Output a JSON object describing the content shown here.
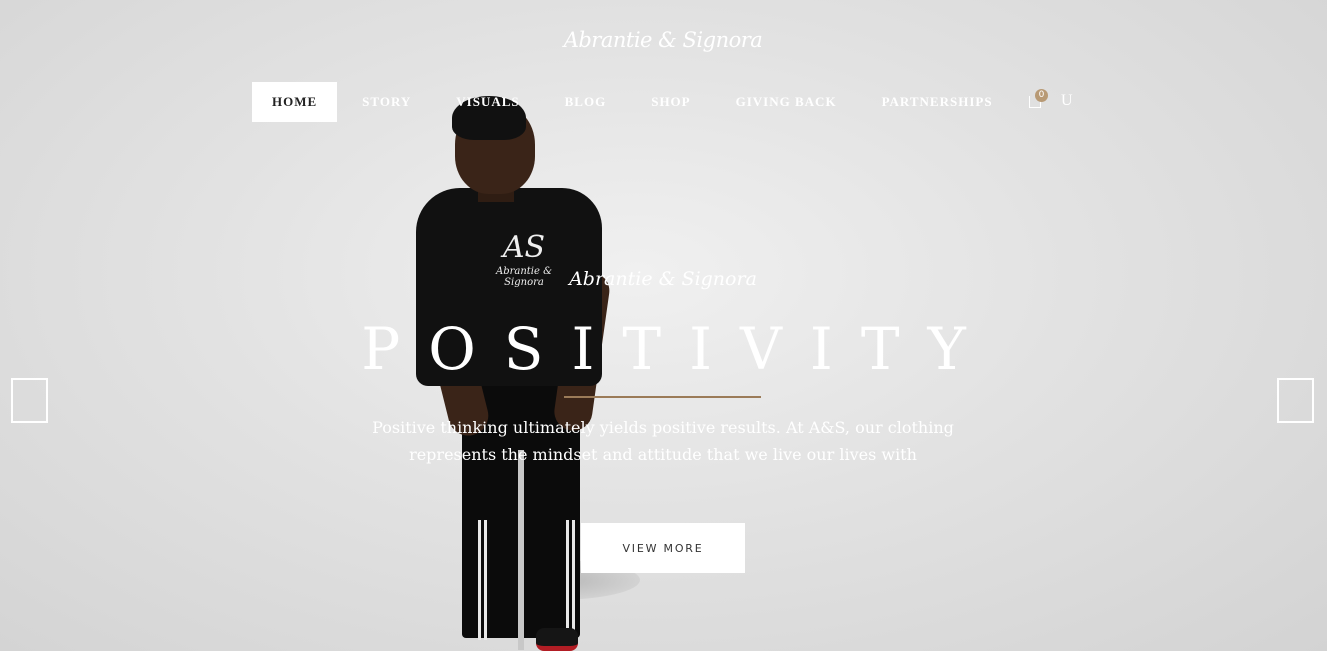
{
  "brand": {
    "logo_text": "Abrantie & Signora"
  },
  "nav": {
    "items": [
      {
        "label": "HOME",
        "active": true
      },
      {
        "label": "STORY",
        "active": false
      },
      {
        "label": "VISUALS",
        "active": false
      },
      {
        "label": "BLOG",
        "active": false
      },
      {
        "label": "SHOP",
        "active": false
      },
      {
        "label": "GIVING BACK",
        "active": false
      },
      {
        "label": "PARTNERSHIPS",
        "active": false
      }
    ],
    "cart_icon": "shopping-bag-icon",
    "cart_count": "0",
    "user_icon": "U"
  },
  "hero": {
    "subtitle": "Abrantie & Signora",
    "title": "POSITIVITY",
    "description_line1": "Positive thinking ultimately yields positive results. At A&S, our clothing",
    "description_line2": "represents the mindset and attitude that we live our lives with",
    "button_label": "VIEW MORE",
    "tshirt_logo_mono": "AS",
    "tshirt_logo_text": "Abrantie & Signora"
  },
  "slider": {
    "prev_icon": "prev-arrow-icon",
    "next_icon": "next-arrow-icon"
  },
  "colors": {
    "accent": "#9b7b58",
    "badge": "#b89a75",
    "background": "#e2e2e2"
  }
}
